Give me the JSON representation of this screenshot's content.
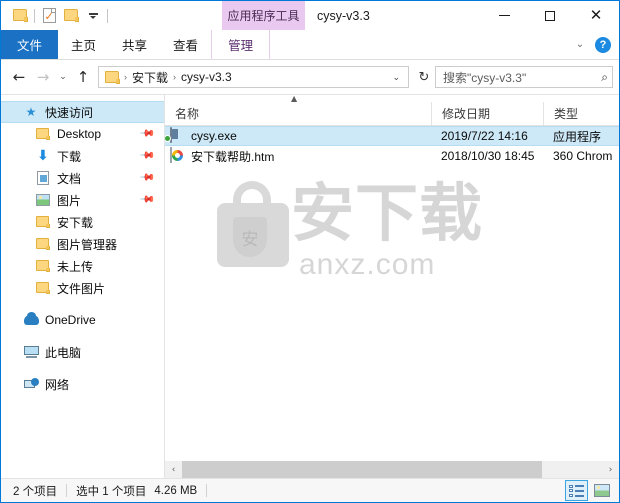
{
  "window": {
    "title": "cysy-v3.3",
    "contextual_tab_header": "应用程序工具",
    "minimize_label": "—",
    "maximize_label": "□",
    "close_label": "✕"
  },
  "quick_access_toolbar": {
    "items": [
      {
        "icon": "folder-icon",
        "name": "qat-folder-button"
      },
      {
        "icon": "properties-icon",
        "name": "qat-properties-button"
      },
      {
        "icon": "new-folder-icon",
        "name": "qat-new-folder-button"
      },
      {
        "icon": "chevron-down-icon",
        "name": "qat-customize-button"
      }
    ]
  },
  "ribbon": {
    "tabs": [
      {
        "label": "文件",
        "selected": true
      },
      {
        "label": "主页",
        "selected": false
      },
      {
        "label": "共享",
        "selected": false
      },
      {
        "label": "查看",
        "selected": false
      }
    ],
    "contextual_tab": {
      "label": "管理"
    },
    "collapse_icon": "chevron-down-icon",
    "help_label": "?"
  },
  "address_bar": {
    "back_label": "←",
    "forward_label": "→",
    "recent_label": "⌄",
    "up_label": "↑",
    "breadcrumbs": [
      {
        "label": "安下载"
      },
      {
        "label": "cysy-v3.3"
      }
    ],
    "separator": "›",
    "dropdown_label": "⌄",
    "refresh_label": "↻"
  },
  "search": {
    "placeholder": "搜索\"cysy-v3.3\"",
    "icon": "search-icon"
  },
  "sidebar": {
    "items": [
      {
        "label": "快速访问",
        "icon": "star-icon",
        "selected": true,
        "pinned": false,
        "indent": false
      },
      {
        "label": "Desktop",
        "icon": "folder-icon",
        "selected": false,
        "pinned": true,
        "indent": true
      },
      {
        "label": "下载",
        "icon": "download-icon",
        "selected": false,
        "pinned": true,
        "indent": true
      },
      {
        "label": "文档",
        "icon": "document-icon",
        "selected": false,
        "pinned": true,
        "indent": true
      },
      {
        "label": "图片",
        "icon": "pictures-icon",
        "selected": false,
        "pinned": true,
        "indent": true
      },
      {
        "label": "安下载",
        "icon": "folder-icon",
        "selected": false,
        "pinned": false,
        "indent": true
      },
      {
        "label": "图片管理器",
        "icon": "folder-icon",
        "selected": false,
        "pinned": false,
        "indent": true
      },
      {
        "label": "未上传",
        "icon": "folder-icon",
        "selected": false,
        "pinned": false,
        "indent": true
      },
      {
        "label": "文件图片",
        "icon": "folder-icon",
        "selected": false,
        "pinned": false,
        "indent": true
      }
    ],
    "roots": [
      {
        "label": "OneDrive",
        "icon": "cloud-icon"
      },
      {
        "label": "此电脑",
        "icon": "computer-icon"
      },
      {
        "label": "网络",
        "icon": "network-icon"
      }
    ]
  },
  "file_list": {
    "sort_indicator": "▲",
    "columns": [
      {
        "label": "名称"
      },
      {
        "label": "修改日期"
      },
      {
        "label": "类型"
      }
    ],
    "rows": [
      {
        "name": "cysy.exe",
        "date": "2019/7/22 14:16",
        "type": "应用程序",
        "icon": "executable-icon",
        "selected": true
      },
      {
        "name": "安下载帮助.htm",
        "date": "2018/10/30 18:45",
        "type": "360 Chrom",
        "icon": "browser-document-icon",
        "selected": false
      }
    ]
  },
  "watermark": {
    "title": "安下载",
    "subtitle": "anxz.com",
    "icon": "shield-bag-icon",
    "shield_glyph": "安"
  },
  "horizontal_scrollbar": {
    "left_arrow": "‹",
    "right_arrow": "›"
  },
  "status_bar": {
    "item_count": "2 个项目",
    "selection": "选中 1 个项目",
    "size": "4.26 MB",
    "views": [
      {
        "name": "details-view-button",
        "icon": "details-view-icon",
        "active": true
      },
      {
        "name": "large-icons-view-button",
        "icon": "thumbnail-view-icon",
        "active": false
      }
    ]
  },
  "colors": {
    "accent": "#1b72c4",
    "selection": "#cde8f6",
    "contextual_tab": "#e9c9f0",
    "window_border": "#0078d7"
  }
}
